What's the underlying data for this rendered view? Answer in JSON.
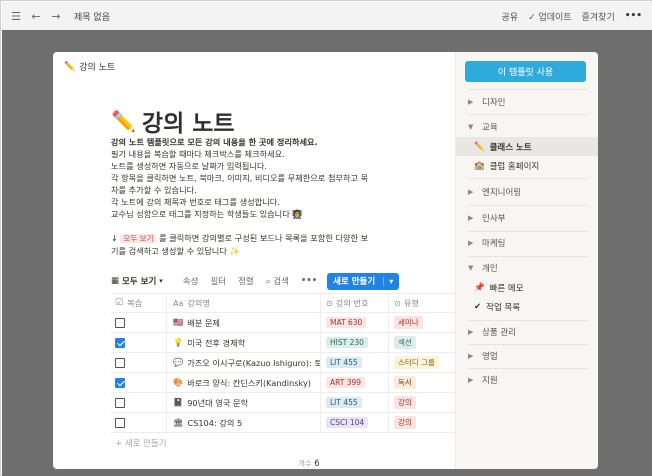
{
  "topbar": {
    "crumb": "제목 없음",
    "share": "공유",
    "updates": "업데이트",
    "favorite": "즐겨찾기",
    "more": "•••"
  },
  "modal": {
    "breadcrumb": "강의 노트",
    "title": "강의 노트",
    "desc_bold": "강의 노트 템플릿으로 모든 강의 내용을 한 곳에 정리하세요.",
    "desc_lines": [
      "필기 내용을 복습할 때마다 체크박스를 체크하세요.",
      "노트를 생성하면 자동으로 날짜가 입력됩니다.",
      "각 항목을 클릭하면 노트, 북마크, 이미지, 비디오를 무제한으로 첨부하고 목",
      "차를 추가할 수 있습니다.",
      "각 노트에 강의 제목과 번호로 태그를 생성합니다.",
      "교수님 성함으로 태그를 지정하는 학생들도 있습니다"
    ],
    "hint_prefix": "↓",
    "hint_tag": "모두 보기",
    "hint_line1": "를 클릭하면 강의별로 구성된 보드나 목록을 포함한 다양한 보",
    "hint_line2": "기를 검색하고 생성할 수 있답니다 ✨",
    "toolbar": {
      "view": "모두 보기",
      "property": "속성",
      "filter": "필터",
      "sort": "정렬",
      "search": "검색",
      "more": "•••",
      "new": "새로 만들기"
    },
    "table": {
      "headers": [
        "복습",
        "강의명",
        "강의 번호",
        "유형"
      ],
      "rows": [
        {
          "checked": false,
          "emoji": "🇺🇸",
          "name": "배분 문제",
          "code": "MAT 630",
          "type": "세미나"
        },
        {
          "checked": true,
          "emoji": "💡",
          "name": "미국 전후 경제학",
          "code": "HIST 230",
          "type": "섹션"
        },
        {
          "checked": false,
          "emoji": "💬",
          "name": "가즈오 이시구로(Kazuo Ishiguro): 토",
          "code": "LIT 455",
          "type": "스터디 그룹"
        },
        {
          "checked": true,
          "emoji": "🎨",
          "name": "바로크 양식: 칸딘스키(Kandinsky)",
          "code": "ART 399",
          "type": "독서"
        },
        {
          "checked": false,
          "emoji": "📓",
          "name": "90년대 영국 문학",
          "code": "LIT 455",
          "type": "강의"
        },
        {
          "checked": false,
          "emoji": "🏛",
          "name": "CS104: 강의 5",
          "code": "CSCI 104",
          "type": "강의"
        }
      ],
      "add_row": "+ 새로 만들기",
      "count_label": "개수",
      "count_value": "6"
    }
  },
  "sidebar": {
    "use_button": "이 템플릿 사용",
    "categories": [
      {
        "label": "디자인",
        "open": false
      },
      {
        "label": "교육",
        "open": true,
        "items": [
          "클래스 노트",
          "클럽 홈페이지"
        ]
      },
      {
        "label": "엔지니어링",
        "open": false
      },
      {
        "label": "인사부",
        "open": false
      },
      {
        "label": "마케팅",
        "open": false
      },
      {
        "label": "개인",
        "open": true,
        "items": [
          "빠른 메모",
          "작업 목록"
        ]
      },
      {
        "label": "상품 관리",
        "open": false
      },
      {
        "label": "영업",
        "open": false
      },
      {
        "label": "지원",
        "open": false
      }
    ]
  },
  "colors": {
    "primary_button": "#2383e2",
    "use_button": "#2eaadc",
    "overlay": "#6e6e6e"
  }
}
